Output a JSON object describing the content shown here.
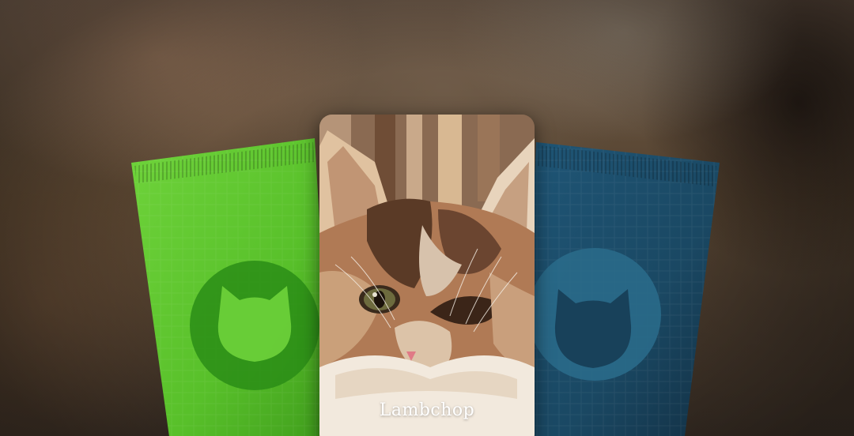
{
  "colors": {
    "green_pouch": "#5cc42a",
    "green_badge": "#2a8d16",
    "blue_pouch": "#1d4f6b",
    "blue_badge": "#2a6a8a",
    "background": "#55432f"
  },
  "pouches": [
    {
      "variant": "green",
      "icon": "cat-head-icon"
    },
    {
      "variant": "blue",
      "icon": "cat-head-icon"
    }
  ],
  "card": {
    "name": "Lambchop",
    "image": "cat-portrait"
  }
}
